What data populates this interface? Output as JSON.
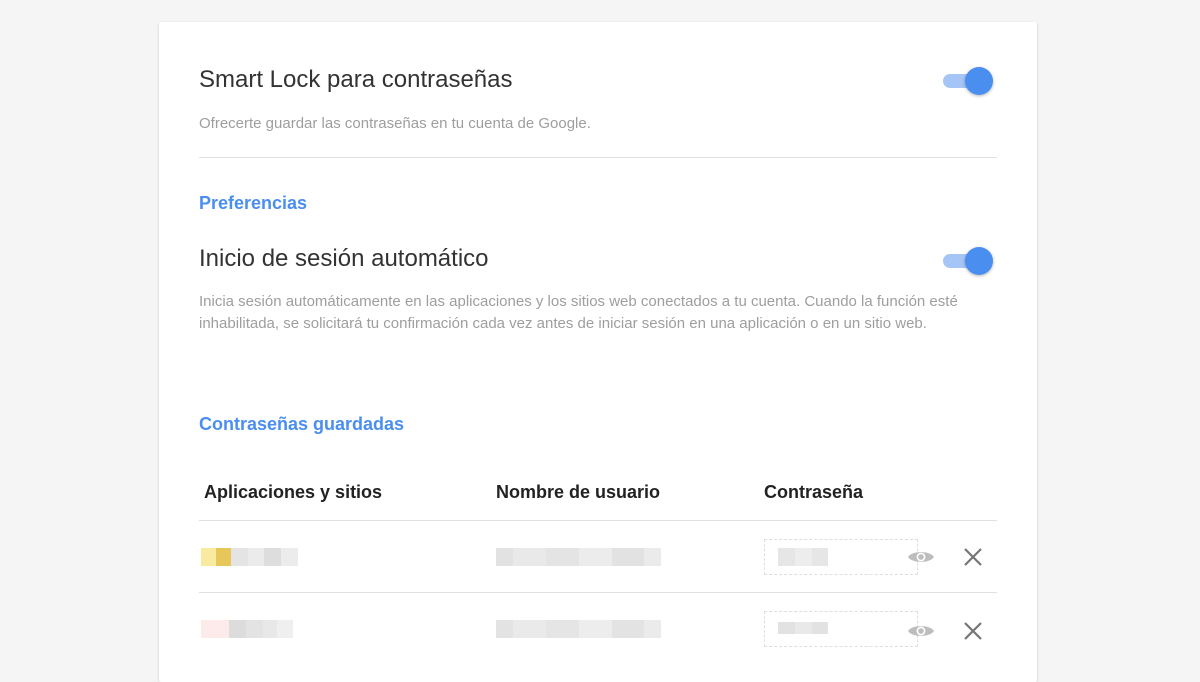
{
  "smart_lock": {
    "title": "Smart Lock para contraseñas",
    "description": "Ofrecerte guardar las contraseñas en tu cuenta de Google.",
    "enabled": true
  },
  "preferences": {
    "heading": "Preferencias",
    "auto_signin": {
      "title": "Inicio de sesión automático",
      "description": "Inicia sesión automáticamente en las aplicaciones y los sitios web conectados a tu cuenta. Cuando la función esté inhabilitada, se solicitará tu confirmación cada vez antes de iniciar sesión en una aplicación o en un sitio web.",
      "enabled": true
    }
  },
  "saved_passwords": {
    "heading": "Contraseñas guardadas",
    "columns": [
      "Aplicaciones y sitios",
      "Nombre de usuario",
      "Contraseña"
    ],
    "rows": [
      {
        "site_icon_color": "#f2d36b"
      },
      {
        "site_icon_color": "#fde7e7"
      }
    ]
  },
  "colors": {
    "accent": "#4a8ef0",
    "toggle_track": "#a6c5f7",
    "secondary_text": "#9e9e9e"
  },
  "icons": {
    "show_password": "eye-icon",
    "remove": "close-icon"
  }
}
